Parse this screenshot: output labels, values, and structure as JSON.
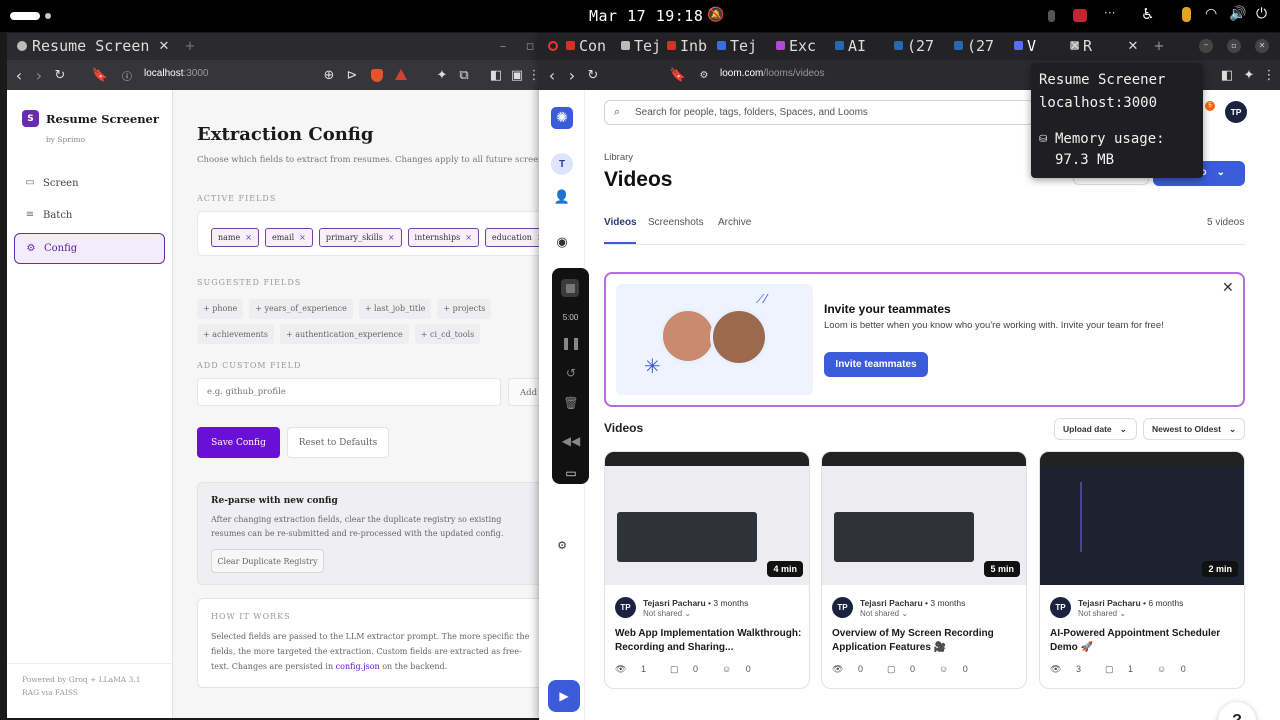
{
  "system": {
    "clock": "Mar 17 19:18"
  },
  "left_browser": {
    "tab_title": "Resume Screen",
    "url_host": "localhost",
    "url_port": ":3000"
  },
  "left_app": {
    "brand_letter": "S",
    "brand_name": "Resume Screener",
    "brand_sub": "by Sprimo",
    "nav": [
      {
        "label": "Screen"
      },
      {
        "label": "Batch"
      },
      {
        "label": "Config"
      }
    ],
    "footer_line1": "Powered by Groq + LLaMA 3.1",
    "footer_line2": "RAG via FAISS",
    "page_title": "Extraction Config",
    "page_desc": "Choose which fields to extract from resumes. Changes apply to all future screenings.",
    "active_label": "ACTIVE FIELDS",
    "active_fields": [
      "name",
      "email",
      "primary_skills",
      "internships",
      "education"
    ],
    "remove_glyph": "×",
    "suggested_label": "SUGGESTED FIELDS",
    "suggested_fields": [
      "+ phone",
      "+ years_of_experience",
      "+ last_job_title",
      "+ projects",
      "+ achievements",
      "+ authentication_experience",
      "+ ci_cd_tools"
    ],
    "custom_label": "ADD CUSTOM FIELD",
    "custom_placeholder": "e.g. github_profile",
    "add_label": "Add",
    "save_label": "Save Config",
    "reset_label": "Reset to Defaults",
    "reparse_title": "Re-parse with new config",
    "reparse_text": "After changing extraction fields, clear the duplicate registry so existing resumes can be re-submitted and re-processed with the updated config.",
    "clear_label": "Clear Duplicate Registry",
    "how_label": "HOW IT WORKS",
    "how_text_a": "Selected fields are passed to the LLM extractor prompt. The more specific the fields, the more targeted the extraction. Custom fields are extracted as free-text. Changes are persisted in ",
    "how_link": "config.json",
    "how_text_b": " on the backend."
  },
  "right_browser": {
    "tabs": [
      "Con",
      "Tej",
      "Inb",
      "Tej",
      "Exc",
      "AI",
      "(27",
      "(27",
      "V",
      "R"
    ],
    "url_host": "loom.com",
    "url_path": "/looms/videos",
    "tooltip_title": "Resume Screener",
    "tooltip_host": "localhost:3000",
    "tooltip_mem_label": "Memory usage:",
    "tooltip_mem_value": "97.3 MB"
  },
  "loom": {
    "search_placeholder": "Search for people, tags, folders, Spaces, and Looms",
    "workspace_initial": "T",
    "user_initials": "TP",
    "notif_count": "5",
    "breadcrumb": "Library",
    "title": "Videos",
    "new_video_label": "eo",
    "tabs": [
      "Videos",
      "Screenshots",
      "Archive"
    ],
    "video_count": "5 videos",
    "record_timer": "5:00",
    "banner_title": "Invite your teammates",
    "banner_text": "Loom is better when you know who you're working with. Invite your team for free!",
    "banner_button": "Invite teammates",
    "section_title": "Videos",
    "sort_a": "Upload date",
    "sort_b": "Newest to Oldest",
    "help_label": "?",
    "videos": [
      {
        "duration": "4 min",
        "initials": "TP",
        "author": "Tejasri Pacharu",
        "age": "3 months",
        "share": "Not shared",
        "title": "Web App Implementation Walkthrough: Recording and Sharing...",
        "views": "1",
        "comments": "0",
        "reactions": "0"
      },
      {
        "duration": "5 min",
        "initials": "TP",
        "author": "Tejasri Pacharu",
        "age": "3 months",
        "share": "Not shared",
        "title": "Overview of My Screen Recording Application Features 🎥",
        "views": "0",
        "comments": "0",
        "reactions": "0"
      },
      {
        "duration": "2 min",
        "initials": "TP",
        "author": "Tejasri Pacharu",
        "age": "6 months",
        "share": "Not shared",
        "title": "AI-Powered Appointment Scheduler Demo 🚀",
        "views": "3",
        "comments": "1",
        "reactions": "0"
      }
    ]
  }
}
